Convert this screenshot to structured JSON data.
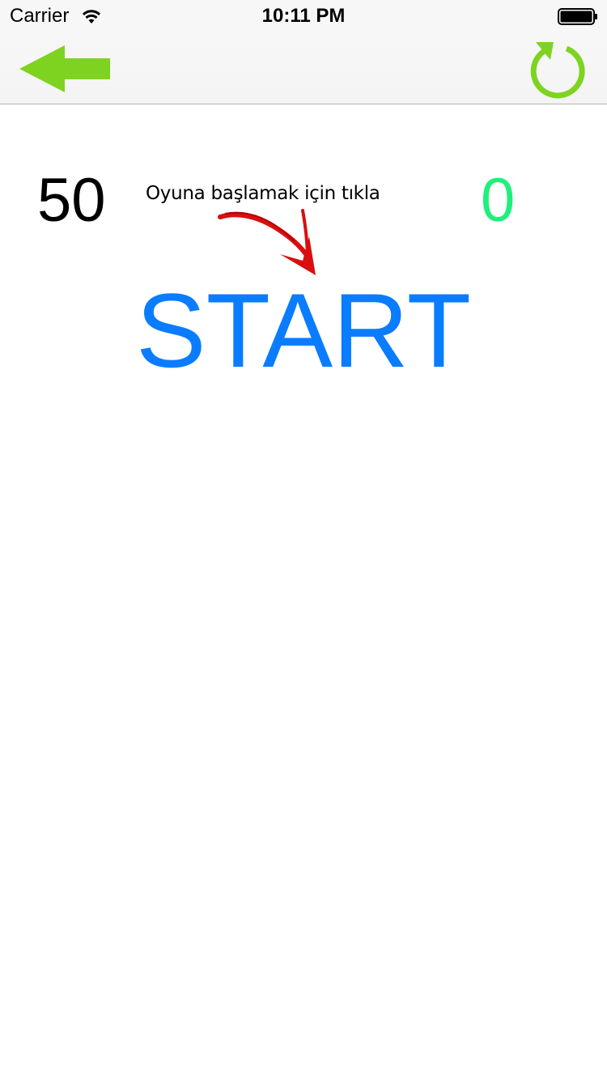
{
  "status_bar": {
    "carrier": "Carrier",
    "time": "10:11 PM"
  },
  "nav_bar": {
    "back_icon": "arrow-left-icon",
    "refresh_icon": "refresh-icon",
    "accent_color": "#7ed321"
  },
  "game": {
    "score_left": "50",
    "score_right": "0",
    "score_right_color": "#1ef07c",
    "hint": "Oyuna başlamak için tıkla",
    "start_label": "START",
    "start_color": "#0a7cff",
    "pointer_icon": "red-arrow-icon"
  }
}
